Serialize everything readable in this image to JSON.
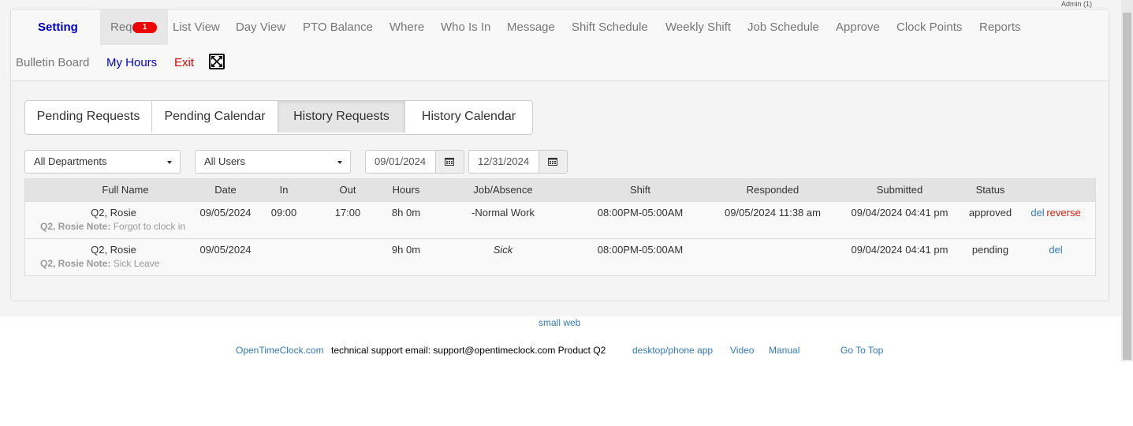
{
  "window": {
    "admin_label": "Admin (1)"
  },
  "nav": {
    "setting": "Setting",
    "req": "Req",
    "req_badge": "1",
    "list_view": "List View",
    "day_view": "Day View",
    "pto_balance": "PTO Balance",
    "where": "Where",
    "who_is_in": "Who Is In",
    "message": "Message",
    "shift_schedule": "Shift Schedule",
    "weekly_shift": "Weekly Shift",
    "job_schedule": "Job Schedule",
    "approve": "Approve",
    "clock_points": "Clock Points",
    "reports": "Reports",
    "bulletin_board": "Bulletin Board",
    "my_hours": "My Hours",
    "exit": "Exit",
    "fullscreen_icon": "fullscreen-icon"
  },
  "tabs": {
    "pending_requests": "Pending Requests",
    "pending_calendar": "Pending Calendar",
    "history_requests": "History Requests",
    "history_calendar": "History Calendar",
    "active": "History Requests"
  },
  "filters": {
    "department": "All Departments",
    "user": "All Users",
    "start_date": "09/01/2024",
    "end_date": "12/31/2024"
  },
  "table": {
    "headers": {
      "full_name": "Full Name",
      "date": "Date",
      "in": "In",
      "out": "Out",
      "hours": "Hours",
      "job": "Job/Absence",
      "shift": "Shift",
      "responded": "Responded",
      "submitted": "Submitted",
      "status": "Status"
    },
    "rows": [
      {
        "full_name": "Q2, Rosie",
        "date": "09/05/2024",
        "in": "09:00",
        "out": "17:00",
        "hours": "8h 0m",
        "job": "-Normal Work",
        "shift": "08:00PM-05:00AM",
        "responded": "09/05/2024 11:38 am",
        "submitted": "09/04/2024 04:41 pm",
        "status": "approved",
        "del": "del",
        "reverse": "reverse",
        "note_label": "Q2, Rosie Note:",
        "note_text": "Forgot to clock in"
      },
      {
        "full_name": "Q2, Rosie",
        "date": "09/05/2024",
        "in": "",
        "out": "",
        "hours": "9h 0m",
        "job": "Sick",
        "shift": "08:00PM-05:00AM",
        "responded": "",
        "submitted": "09/04/2024 04:41 pm",
        "status": "pending",
        "del": "del",
        "note_label": "Q2, Rosie Note:",
        "note_text": "Sick Leave"
      }
    ]
  },
  "footer": {
    "small_web": "small web",
    "site_link": "OpenTimeClock.com",
    "support_text": "technical support email: support@opentimeclock.com Product Q2",
    "app_link": "desktop/phone app",
    "video_link": "Video",
    "manual_link": "Manual",
    "top_link": "Go To Top"
  },
  "colors": {
    "accent": "#337ab7",
    "nav_blue": "#0000cc",
    "danger": "#d9230f",
    "badge": "#ee0000"
  }
}
